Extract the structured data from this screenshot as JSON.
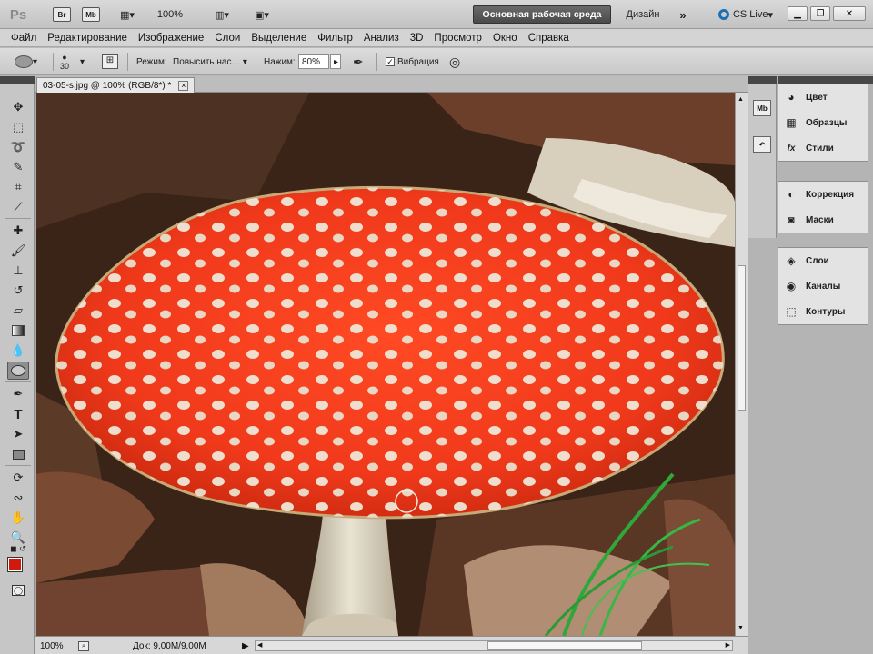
{
  "appbar": {
    "logo": "Ps",
    "bridge": "Br",
    "mini_bridge": "Mb",
    "zoom": "100%",
    "workspace_active": "Основная рабочая среда",
    "workspace_design": "Дизайн",
    "more": "»",
    "cs_live": "CS Live"
  },
  "menu": [
    "Файл",
    "Редактирование",
    "Изображение",
    "Слои",
    "Выделение",
    "Фильтр",
    "Анализ",
    "3D",
    "Просмотр",
    "Окно",
    "Справка"
  ],
  "options": {
    "brush_size": "30",
    "mode_label": "Режим:",
    "mode_value": "Повысить нас...",
    "pressure_label": "Нажим:",
    "pressure_value": "80%",
    "vibrance_label": "Вибрация",
    "vibrance_checked": true
  },
  "document": {
    "tab_title": "03-05-s.jpg @ 100% (RGB/8*) *",
    "close": "×"
  },
  "status": {
    "zoom": "100%",
    "doc_info": "Док: 9,00M/9,00M"
  },
  "dock": {
    "mini_bridge": "Mb",
    "group1": [
      "Цвет",
      "Образцы",
      "Стили"
    ],
    "group2": [
      "Коррекция",
      "Маски"
    ],
    "group3": [
      "Слои",
      "Каналы",
      "Контуры"
    ]
  }
}
